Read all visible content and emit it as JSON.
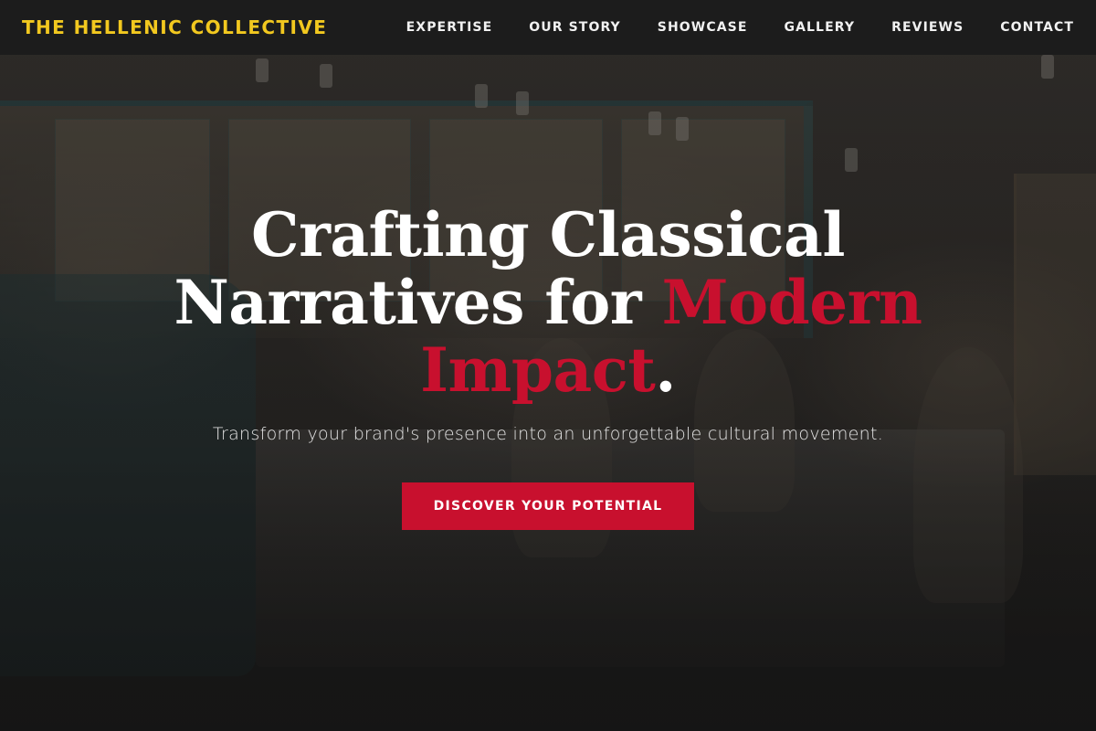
{
  "navbar": {
    "brand": "THE HELLENIC COLLECTIVE",
    "links": [
      {
        "label": "EXPERTISE"
      },
      {
        "label": "OUR STORY"
      },
      {
        "label": "SHOWCASE"
      },
      {
        "label": "GALLERY"
      },
      {
        "label": "REVIEWS"
      },
      {
        "label": "CONTACT"
      }
    ]
  },
  "hero": {
    "title_line1": "Crafting Classical",
    "title_line2": "Narratives for ",
    "title_accent": "Modern Impact",
    "title_period": ".",
    "subtitle": "Transform your brand's presence into an unforgettable cultural movement.",
    "cta_label": "DISCOVER YOUR POTENTIAL"
  },
  "colors": {
    "brand_gold": "#f2c81f",
    "accent_red": "#c8102e",
    "nav_bg": "#1c1c1c",
    "text_white": "#ffffff"
  }
}
